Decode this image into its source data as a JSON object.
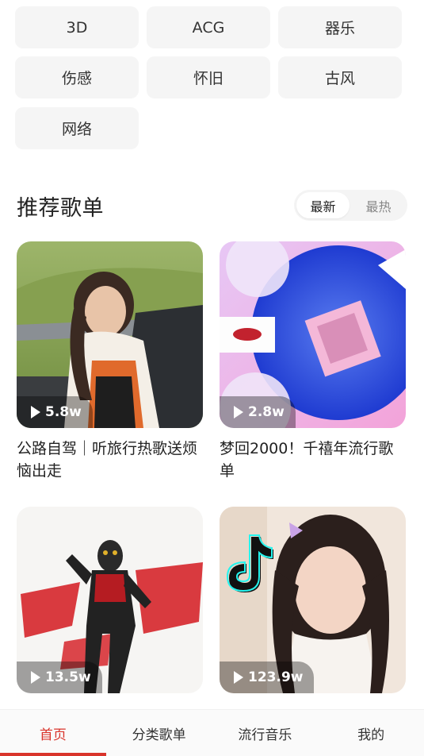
{
  "genres": [
    "3D",
    "ACG",
    "器乐",
    "伤感",
    "怀旧",
    "古风",
    "网络"
  ],
  "section": {
    "title": "推荐歌单",
    "sort_options": [
      "最新",
      "最热"
    ],
    "active_sort": "最新"
  },
  "playlists": [
    {
      "plays": "5.8w",
      "title": "公路自驾｜听旅行热歌送烦恼出走"
    },
    {
      "plays": "2.8w",
      "title": "梦回2000！千禧年流行歌单"
    },
    {
      "plays": "13.5w",
      "title": ""
    },
    {
      "plays": "123.9w",
      "title": ""
    }
  ],
  "bottom_nav": {
    "items": [
      "首页",
      "分类歌单",
      "流行音乐",
      "我的"
    ],
    "active": "首页"
  },
  "colors": {
    "accent": "#d9342b",
    "chip_bg": "#f5f5f5"
  }
}
